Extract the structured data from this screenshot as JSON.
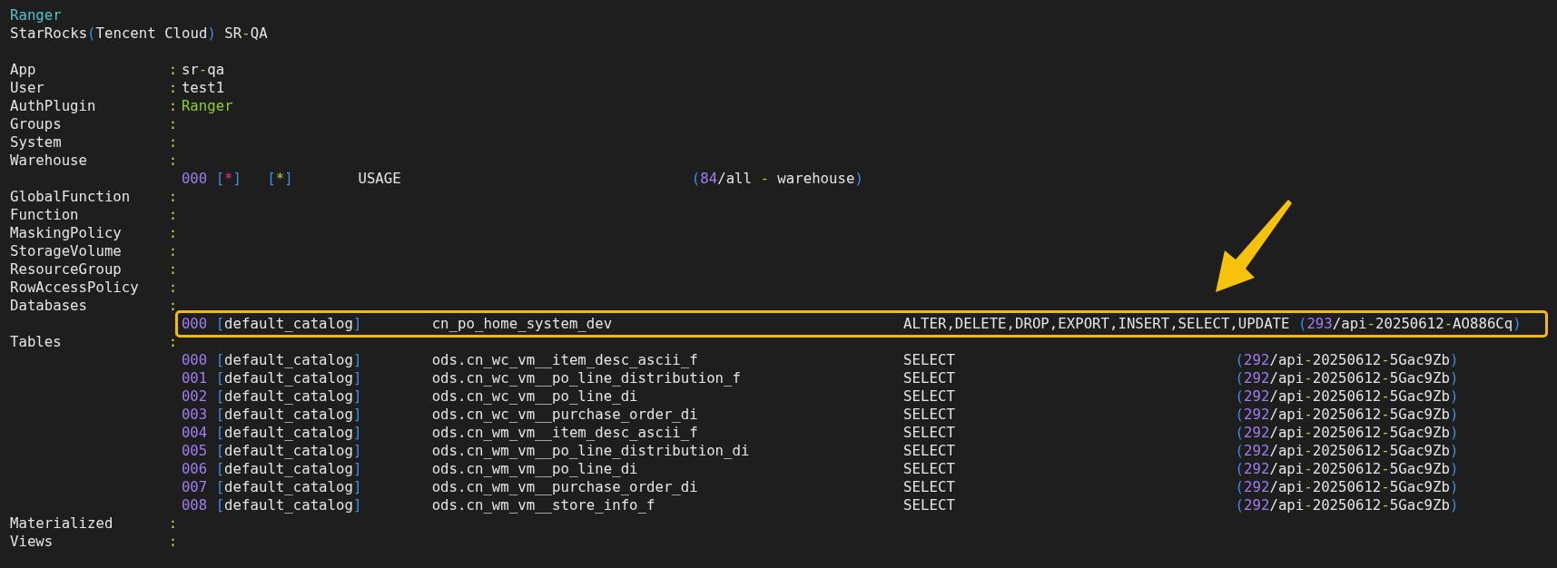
{
  "header": {
    "title": "Ranger",
    "subtitle": "StarRocks(Tencent Cloud) SR-QA"
  },
  "fields": [
    {
      "label": "App",
      "separator": ":",
      "value": "sr-qa",
      "kind": "plain"
    },
    {
      "label": "User",
      "separator": ":",
      "value": "test1",
      "kind": "plain"
    },
    {
      "label": "AuthPlugin",
      "separator": ":",
      "value": "Ranger",
      "kind": "plugin"
    },
    {
      "label": "Groups",
      "separator": ":",
      "kind": "plain"
    },
    {
      "label": "System",
      "separator": ":",
      "kind": "plain"
    },
    {
      "label": "Warehouse",
      "separator": ":",
      "kind": "wildcard",
      "entries": [
        {
          "index": "000",
          "catalog": "[*]",
          "object": "[*]",
          "privileges": "USAGE",
          "source": "(84/all - warehouse)",
          "highlighted": false
        }
      ]
    },
    {
      "label": "GlobalFunction",
      "separator": ":",
      "kind": "plain"
    },
    {
      "label": "Function",
      "separator": ":",
      "kind": "plain"
    },
    {
      "label": "MaskingPolicy",
      "separator": ":",
      "kind": "plain"
    },
    {
      "label": "StorageVolume",
      "separator": ":",
      "kind": "plain"
    },
    {
      "label": "ResourceGroup",
      "separator": ":",
      "kind": "plain"
    },
    {
      "label": "RowAccessPolicy",
      "separator": ":",
      "kind": "plain"
    },
    {
      "label": "Databases",
      "separator": ":",
      "kind": "database",
      "entries": [
        {
          "index": "000",
          "catalog": "[default_catalog]",
          "object": "cn_po_home_system_dev",
          "privileges": "ALTER,DELETE,DROP,EXPORT,INSERT,SELECT,UPDATE",
          "source": "(293/api-20250612-AO886Cq)",
          "highlighted": true
        }
      ]
    },
    {
      "label": "Tables",
      "separator": ":",
      "kind": "table",
      "entries": [
        {
          "index": "000",
          "catalog": "[default_catalog]",
          "object": "ods.cn_wc_vm__item_desc_ascii_f",
          "privileges": "SELECT",
          "source": "(292/api-20250612-5Gac9Zb)",
          "highlighted": false
        },
        {
          "index": "001",
          "catalog": "[default_catalog]",
          "object": "ods.cn_wc_vm__po_line_distribution_f",
          "privileges": "SELECT",
          "source": "(292/api-20250612-5Gac9Zb)",
          "highlighted": false
        },
        {
          "index": "002",
          "catalog": "[default_catalog]",
          "object": "ods.cn_wc_vm__po_line_di",
          "privileges": "SELECT",
          "source": "(292/api-20250612-5Gac9Zb)",
          "highlighted": false
        },
        {
          "index": "003",
          "catalog": "[default_catalog]",
          "object": "ods.cn_wc_vm__purchase_order_di",
          "privileges": "SELECT",
          "source": "(292/api-20250612-5Gac9Zb)",
          "highlighted": false
        },
        {
          "index": "004",
          "catalog": "[default_catalog]",
          "object": "ods.cn_wm_vm__item_desc_ascii_f",
          "privileges": "SELECT",
          "source": "(292/api-20250612-5Gac9Zb)",
          "highlighted": false
        },
        {
          "index": "005",
          "catalog": "[default_catalog]",
          "object": "ods.cn_wm_vm__po_line_distribution_di",
          "privileges": "SELECT",
          "source": "(292/api-20250612-5Gac9Zb)",
          "highlighted": false
        },
        {
          "index": "006",
          "catalog": "[default_catalog]",
          "object": "ods.cn_wm_vm__po_line_di",
          "privileges": "SELECT",
          "source": "(292/api-20250612-5Gac9Zb)",
          "highlighted": false
        },
        {
          "index": "007",
          "catalog": "[default_catalog]",
          "object": "ods.cn_wm_vm__purchase_order_di",
          "privileges": "SELECT",
          "source": "(292/api-20250612-5Gac9Zb)",
          "highlighted": false
        },
        {
          "index": "008",
          "catalog": "[default_catalog]",
          "object": "ods.cn_wm_vm__store_info_f",
          "privileges": "SELECT",
          "source": "(292/api-20250612-5Gac9Zb)",
          "highlighted": false
        }
      ]
    },
    {
      "label": "Materialized",
      "separator": ":",
      "kind": "plain"
    },
    {
      "label": "Views",
      "separator": ":",
      "kind": "plain"
    }
  ]
}
